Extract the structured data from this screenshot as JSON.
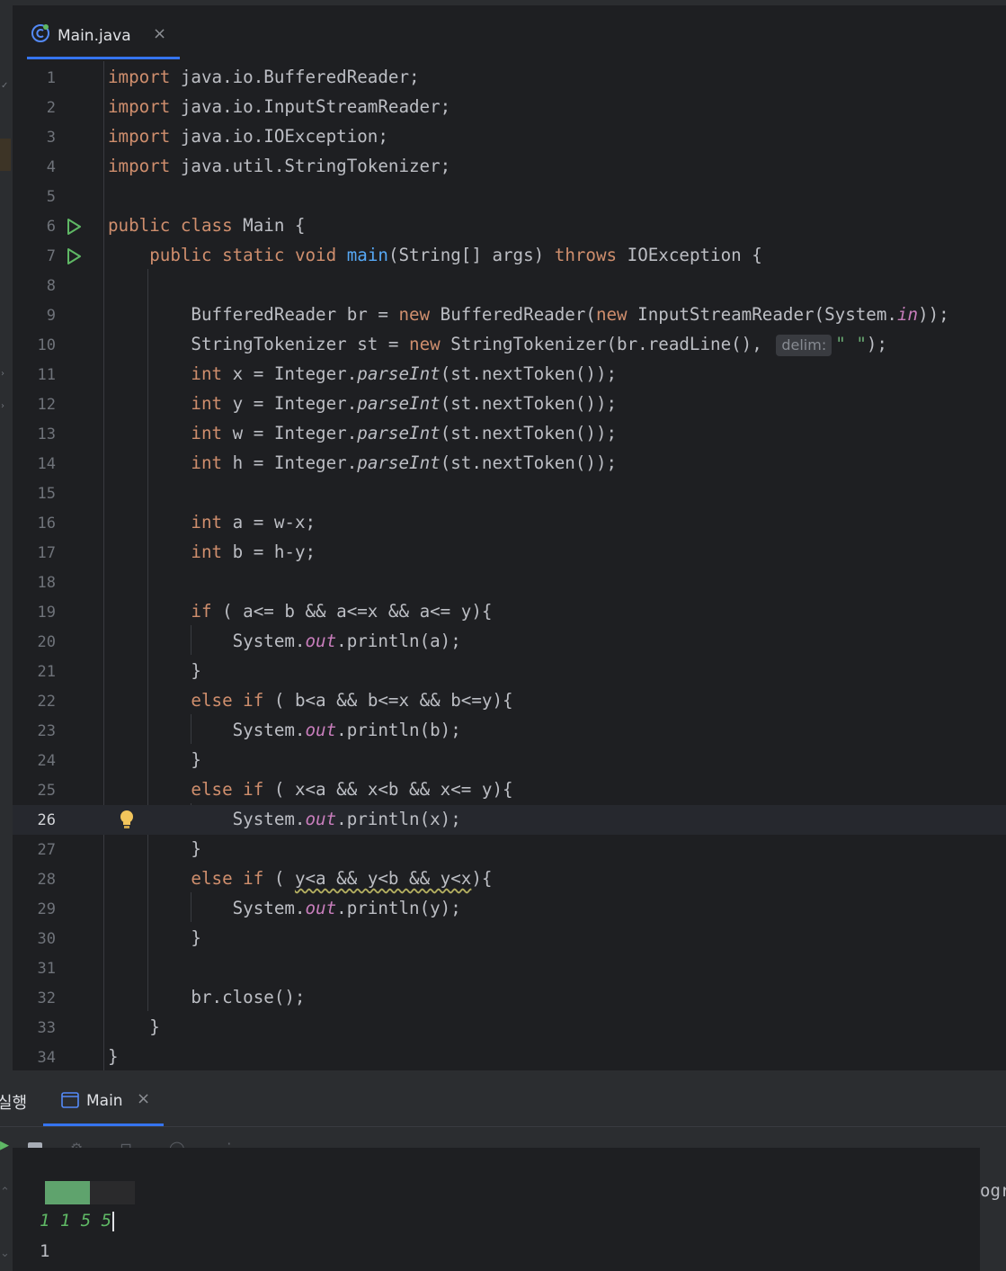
{
  "editor_tab": {
    "file_name": "Main.java",
    "close_glyph": "×",
    "icon": "java-class-icon"
  },
  "code_lines": [
    {
      "n": "1",
      "html": "<span class=\"kw\">import</span> java.io.BufferedReader;"
    },
    {
      "n": "2",
      "html": "<span class=\"kw\">import</span> java.io.InputStreamReader;"
    },
    {
      "n": "3",
      "html": "<span class=\"kw\">import</span> java.io.IOException;"
    },
    {
      "n": "4",
      "html": "<span class=\"kw\">import</span> java.util.StringTokenizer;"
    },
    {
      "n": "5",
      "html": ""
    },
    {
      "n": "6",
      "html": "<span class=\"kw\">public class</span> Main {",
      "run": true
    },
    {
      "n": "7",
      "html": "    <span class=\"kw\">public static void</span> <span class=\"fn\">main</span>(String[] args) <span class=\"kw\">throws</span> IOException {",
      "run": true
    },
    {
      "n": "8",
      "html": ""
    },
    {
      "n": "9",
      "html": "        BufferedReader br = <span class=\"kw\">new</span> BufferedReader(<span class=\"kw\">new</span> InputStreamReader(System.<span class=\"st\">in</span>));"
    },
    {
      "n": "10",
      "html": "        StringTokenizer st = <span class=\"kw\">new</span> StringTokenizer(br.readLine(), <span class=\"hint\">delim:</span><span class=\"str\">\" \"</span>);"
    },
    {
      "n": "11",
      "html": "        <span class=\"kw\">int</span> x = Integer.<span class=\"it\">parseInt</span>(st.nextToken());"
    },
    {
      "n": "12",
      "html": "        <span class=\"kw\">int</span> y = Integer.<span class=\"it\">parseInt</span>(st.nextToken());"
    },
    {
      "n": "13",
      "html": "        <span class=\"kw\">int</span> w = Integer.<span class=\"it\">parseInt</span>(st.nextToken());"
    },
    {
      "n": "14",
      "html": "        <span class=\"kw\">int</span> h = Integer.<span class=\"it\">parseInt</span>(st.nextToken());"
    },
    {
      "n": "15",
      "html": ""
    },
    {
      "n": "16",
      "html": "        <span class=\"kw\">int</span> a = w-x;"
    },
    {
      "n": "17",
      "html": "        <span class=\"kw\">int</span> b = h-y;"
    },
    {
      "n": "18",
      "html": ""
    },
    {
      "n": "19",
      "html": "        <span class=\"kw\">if</span> ( a&lt;= b &amp;&amp; a&lt;=x &amp;&amp; a&lt;= y){"
    },
    {
      "n": "20",
      "html": "            System.<span class=\"st\">out</span>.println(a);"
    },
    {
      "n": "21",
      "html": "        }"
    },
    {
      "n": "22",
      "html": "        <span class=\"kw\">else if</span> ( b&lt;a &amp;&amp; b&lt;=x &amp;&amp; b&lt;=y){"
    },
    {
      "n": "23",
      "html": "            System.<span class=\"st\">out</span>.println(b);"
    },
    {
      "n": "24",
      "html": "        }"
    },
    {
      "n": "25",
      "html": "        <span class=\"kw\">else if</span> ( x&lt;a &amp;&amp; x&lt;b &amp;&amp; x&lt;= y){"
    },
    {
      "n": "26",
      "html": "            System.<span class=\"st\">out</span>.println(x);",
      "current": true,
      "bulb": true
    },
    {
      "n": "27",
      "html": "        }"
    },
    {
      "n": "28",
      "html": "        <span class=\"kw\">else if</span> ( <span class=\"warn\">y&lt;a &amp;&amp; y&lt;b &amp;&amp; y&lt;x</span>){"
    },
    {
      "n": "29",
      "html": "            System.<span class=\"st\">out</span>.println(y);"
    },
    {
      "n": "30",
      "html": "        }"
    },
    {
      "n": "31",
      "html": ""
    },
    {
      "n": "32",
      "html": "        br.close();"
    },
    {
      "n": "33",
      "html": "    }"
    },
    {
      "n": "34",
      "html": "}"
    }
  ],
  "run_panel": {
    "tool_window_label": "실행",
    "tab_label": "Main",
    "close_glyph": "×",
    "toolbar_faint_glyphs": "⚙ ⊡ ◯ ⋮",
    "console_input": "1 1 5 5",
    "console_output": "1",
    "clipped_text": "ogr",
    "progress_fraction": 0.5
  },
  "colors": {
    "accent": "#3574f0",
    "keyword": "#cf8e6d",
    "method": "#56a8f5",
    "static_field": "#c77dbb",
    "string": "#6aab73",
    "console_input": "#5fb865"
  }
}
